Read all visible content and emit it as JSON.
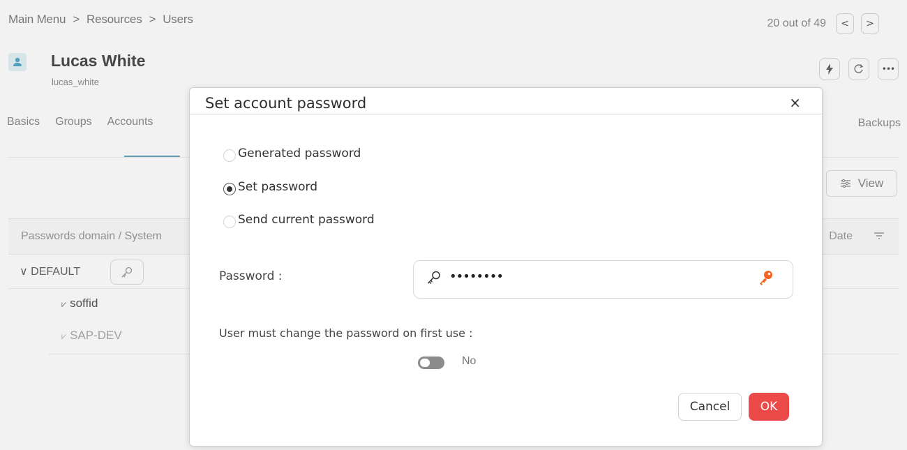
{
  "breadcrumb": {
    "items": [
      "Main Menu",
      "Resources",
      "Users"
    ],
    "separator": ">"
  },
  "pager": {
    "text": "20 out of 49",
    "prev": "<",
    "next": ">"
  },
  "user": {
    "name": "Lucas White",
    "login": "lucas_white",
    "avatar_icon": "user-icon"
  },
  "header_actions": {
    "icons": [
      "bolt-icon",
      "refresh-icon",
      "more-icon"
    ],
    "more_label": "•••"
  },
  "tabs": {
    "items": [
      "Basics",
      "Groups",
      "Accounts"
    ],
    "right": "Backups",
    "active": "Accounts"
  },
  "view_button": {
    "label": "View",
    "icon": "settings-sliders-icon"
  },
  "accounts_table": {
    "headers": {
      "left": "Passwords domain / System",
      "right": "Date",
      "filter_icon": "filter-icon"
    },
    "group": {
      "caret": "∨",
      "label": "DEFAULT"
    },
    "rows": [
      {
        "system": "soffid",
        "icon": "check-icon"
      },
      {
        "system": "SAP-DEV",
        "icon": "check-icon"
      }
    ]
  },
  "modal": {
    "title": "Set account password",
    "close_symbol": "×",
    "options": [
      {
        "label": "Generated password",
        "selected": false
      },
      {
        "label": "Set password",
        "selected": true
      },
      {
        "label": "Send current password",
        "selected": false
      }
    ],
    "password_label": "Password :",
    "password_value": "••••••••",
    "must_change_label": "User must change the password on first use :",
    "must_change_value": "No",
    "cancel_label": "Cancel",
    "ok_label": "OK"
  },
  "colors": {
    "accent_tab": "#67a7bd",
    "ok_button": "#ec4a48",
    "key_orange": "#f26522"
  }
}
